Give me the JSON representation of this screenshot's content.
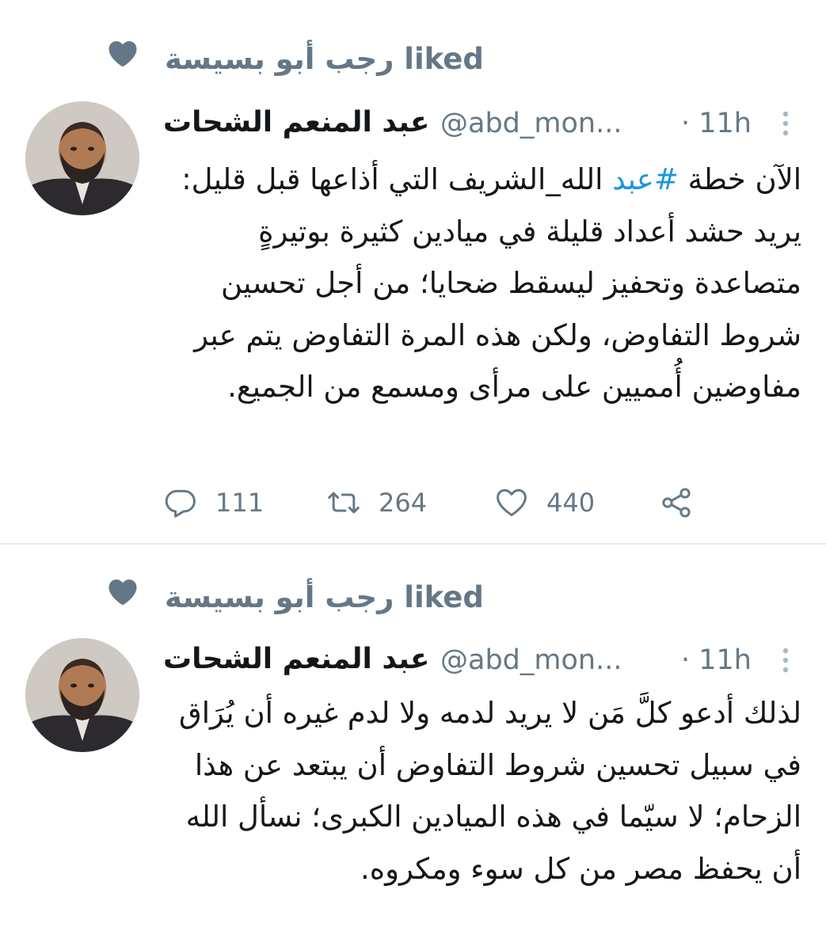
{
  "colors": {
    "text_primary": "#14171a",
    "text_secondary": "#657786",
    "hashtag": "#1b95e0",
    "divider": "#e6ecf0"
  },
  "tweets": [
    {
      "social_context": "رجب أبو بسيسة liked",
      "social_icon": "heart-icon",
      "author": {
        "display_name": "عبد المنعم الشحات",
        "handle": "@abd_mon...",
        "avatar_icon": "avatar-photo"
      },
      "time": "· 11h",
      "text_before_hashtag": "الآن خطة ",
      "hashtag": "#عبد",
      "text_after_hashtag": " الله_الشريف التي أذاعها قبل قليل: يريد حشد أعداد قليلة في ميادين كثيرة بوتيرةٍ متصاعدة وتحفيز ليسقط ضحايا؛ من أجل تحسين شروط التفاوض، ولكن هذه المرة التفاوض يتم عبر مفاوضين أُمميين على مرأى ومسمع من الجميع.",
      "actions": {
        "reply_count": "111",
        "retweet_count": "264",
        "like_count": "440"
      }
    },
    {
      "social_context": "رجب أبو بسيسة liked",
      "social_icon": "heart-icon",
      "author": {
        "display_name": "عبد المنعم الشحات",
        "handle": "@abd_mon...",
        "avatar_icon": "avatar-photo"
      },
      "time": "· 11h",
      "text": "لذلك أدعو كلَّ مَن لا يريد لدمه ولا لدم غيره أن يُرَاق في سبيل تحسين شروط التفاوض أن يبتعد عن هذا الزحام؛ لا سيّما في هذه الميادين الكبرى؛ نسأل الله أن يحفظ مصر من كل سوء ومكروه."
    }
  ]
}
